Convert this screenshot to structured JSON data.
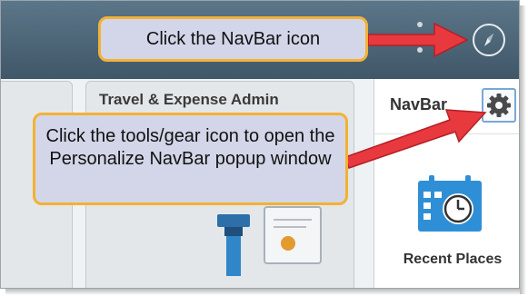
{
  "tile": {
    "title": "Travel & Expense Admin"
  },
  "navbar_panel": {
    "title": "NavBar",
    "item": {
      "label": "Recent Places"
    }
  },
  "callouts": {
    "navbar_icon": "Click the NavBar icon",
    "tools_gear": "Click the tools/gear icon to open the Personalize NavBar popup window"
  },
  "icons": {
    "navbar": "compass-icon",
    "more": "vertical-ellipsis-icon",
    "tools": "gear-icon",
    "recent_places": "calendar-clock-icon",
    "tile": "expense-document-icon"
  },
  "colors": {
    "header": "#4b6475",
    "callout_fill": "#d3d6e8",
    "callout_border": "#f2b233",
    "arrow": "#e8393f",
    "icon_blue": "#2f8fd6"
  }
}
